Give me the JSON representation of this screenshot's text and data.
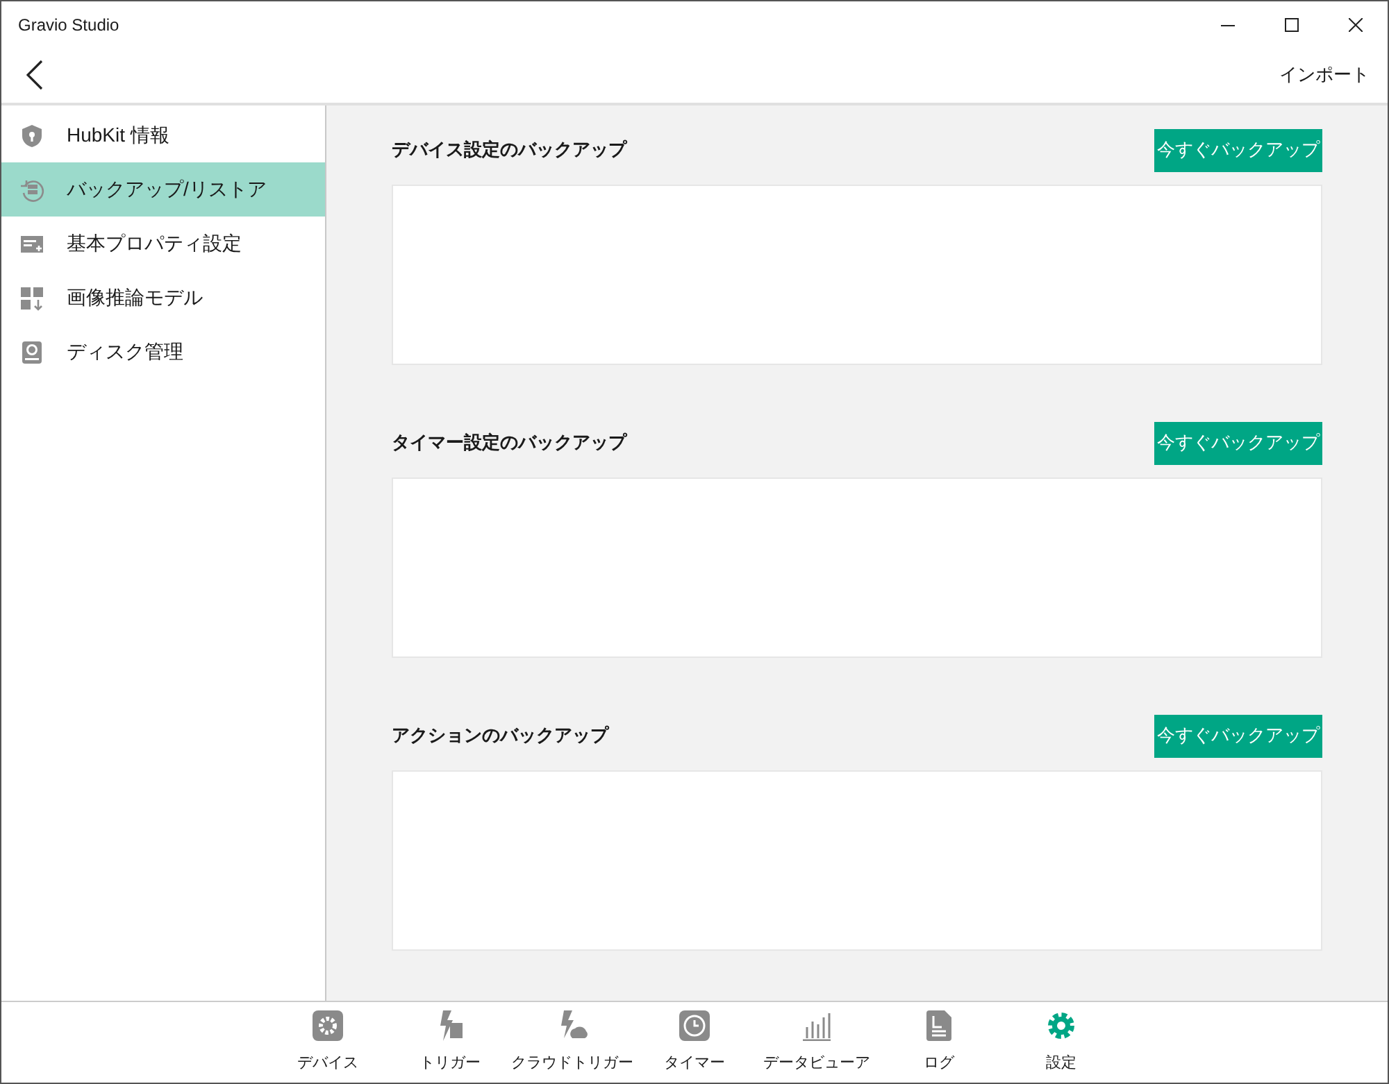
{
  "window": {
    "title": "Gravio Studio"
  },
  "header": {
    "action": "インポート"
  },
  "sidebar": {
    "items": [
      {
        "label": "HubKit 情報",
        "selected": false
      },
      {
        "label": "バックアップ/リストア",
        "selected": true
      },
      {
        "label": "基本プロパティ設定",
        "selected": false
      },
      {
        "label": "画像推論モデル",
        "selected": false
      },
      {
        "label": "ディスク管理",
        "selected": false
      }
    ]
  },
  "sections": [
    {
      "title": "デバイス設定のバックアップ",
      "button": "今すぐバックアップ"
    },
    {
      "title": "タイマー設定のバックアップ",
      "button": "今すぐバックアップ"
    },
    {
      "title": "アクションのバックアップ",
      "button": "今すぐバックアップ"
    }
  ],
  "bottom_nav": [
    {
      "label": "デバイス",
      "selected": false
    },
    {
      "label": "トリガー",
      "selected": false
    },
    {
      "label": "クラウドトリガー",
      "selected": false
    },
    {
      "label": "タイマー",
      "selected": false
    },
    {
      "label": "データビューア",
      "selected": false
    },
    {
      "label": "ログ",
      "selected": false
    },
    {
      "label": "設定",
      "selected": true
    }
  ]
}
